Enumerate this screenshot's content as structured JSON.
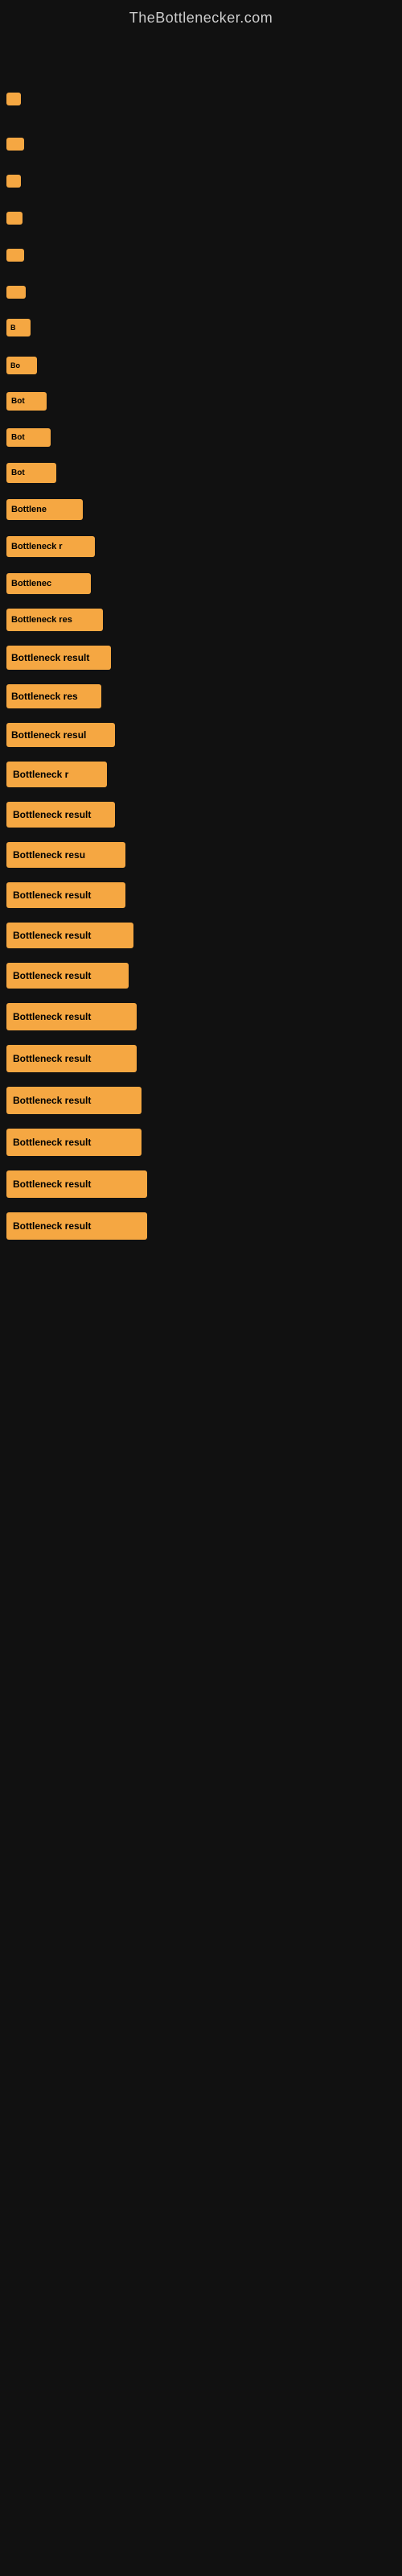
{
  "site": {
    "title": "TheBottlenecker.com"
  },
  "items": [
    {
      "id": 1,
      "label": ""
    },
    {
      "id": 2,
      "label": ""
    },
    {
      "id": 3,
      "label": ""
    },
    {
      "id": 4,
      "label": ""
    },
    {
      "id": 5,
      "label": ""
    },
    {
      "id": 6,
      "label": ""
    },
    {
      "id": 7,
      "label": "B"
    },
    {
      "id": 8,
      "label": "Bo"
    },
    {
      "id": 9,
      "label": "Bot"
    },
    {
      "id": 10,
      "label": "Bot"
    },
    {
      "id": 11,
      "label": "Bot"
    },
    {
      "id": 12,
      "label": "Bottlene"
    },
    {
      "id": 13,
      "label": "Bottleneck r"
    },
    {
      "id": 14,
      "label": "Bottlenec"
    },
    {
      "id": 15,
      "label": "Bottleneck res"
    },
    {
      "id": 16,
      "label": "Bottleneck result"
    },
    {
      "id": 17,
      "label": "Bottleneck res"
    },
    {
      "id": 18,
      "label": "Bottleneck resul"
    },
    {
      "id": 19,
      "label": "Bottleneck r"
    },
    {
      "id": 20,
      "label": "Bottleneck result"
    },
    {
      "id": 21,
      "label": "Bottleneck resu"
    },
    {
      "id": 22,
      "label": "Bottleneck result"
    },
    {
      "id": 23,
      "label": "Bottleneck result"
    },
    {
      "id": 24,
      "label": "Bottleneck result"
    },
    {
      "id": 25,
      "label": "Bottleneck result"
    },
    {
      "id": 26,
      "label": "Bottleneck result"
    },
    {
      "id": 27,
      "label": "Bottleneck result"
    },
    {
      "id": 28,
      "label": "Bottleneck result"
    },
    {
      "id": 29,
      "label": "Bottleneck result"
    },
    {
      "id": 30,
      "label": "Bottleneck result"
    }
  ]
}
